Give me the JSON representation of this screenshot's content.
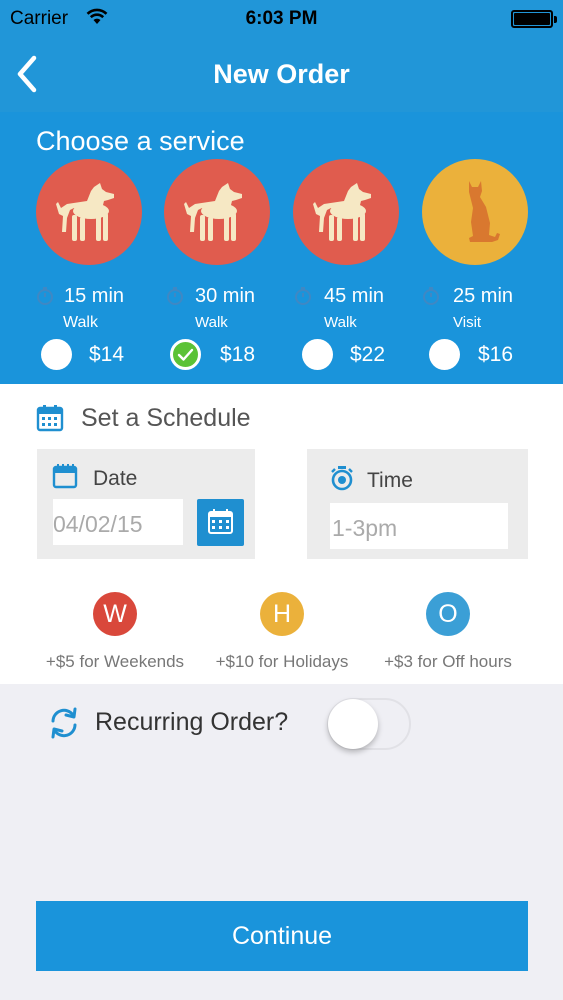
{
  "status_bar": {
    "carrier": "Carrier",
    "time": "6:03 PM"
  },
  "nav": {
    "title": "New Order"
  },
  "services": {
    "heading": "Choose a service",
    "items": [
      {
        "duration": "15 min",
        "kind": "Walk",
        "price": "$14",
        "selected": false,
        "animal": "dog",
        "color": "#e05c4e"
      },
      {
        "duration": "30 min",
        "kind": "Walk",
        "price": "$18",
        "selected": true,
        "animal": "dog",
        "color": "#e05c4e"
      },
      {
        "duration": "45 min",
        "kind": "Walk",
        "price": "$22",
        "selected": false,
        "animal": "dog",
        "color": "#e05c4e"
      },
      {
        "duration": "25 min",
        "kind": "Visit",
        "price": "$16",
        "selected": false,
        "animal": "cat",
        "color": "#ebb13b"
      }
    ]
  },
  "schedule": {
    "heading": "Set a Schedule",
    "date": {
      "label": "Date",
      "value": "04/02/15"
    },
    "time": {
      "label": "Time",
      "placeholder": "1-3pm"
    },
    "surcharges": [
      {
        "letter": "W",
        "text": "+$5 for Weekends",
        "color": "#d9483b"
      },
      {
        "letter": "H",
        "text": "+$10 for Holidays",
        "color": "#ebb13b"
      },
      {
        "letter": "O",
        "text": "+$3 for Off hours",
        "color": "#3b9fd6"
      }
    ]
  },
  "recurring": {
    "label": "Recurring Order?",
    "enabled": false
  },
  "continue_label": "Continue"
}
